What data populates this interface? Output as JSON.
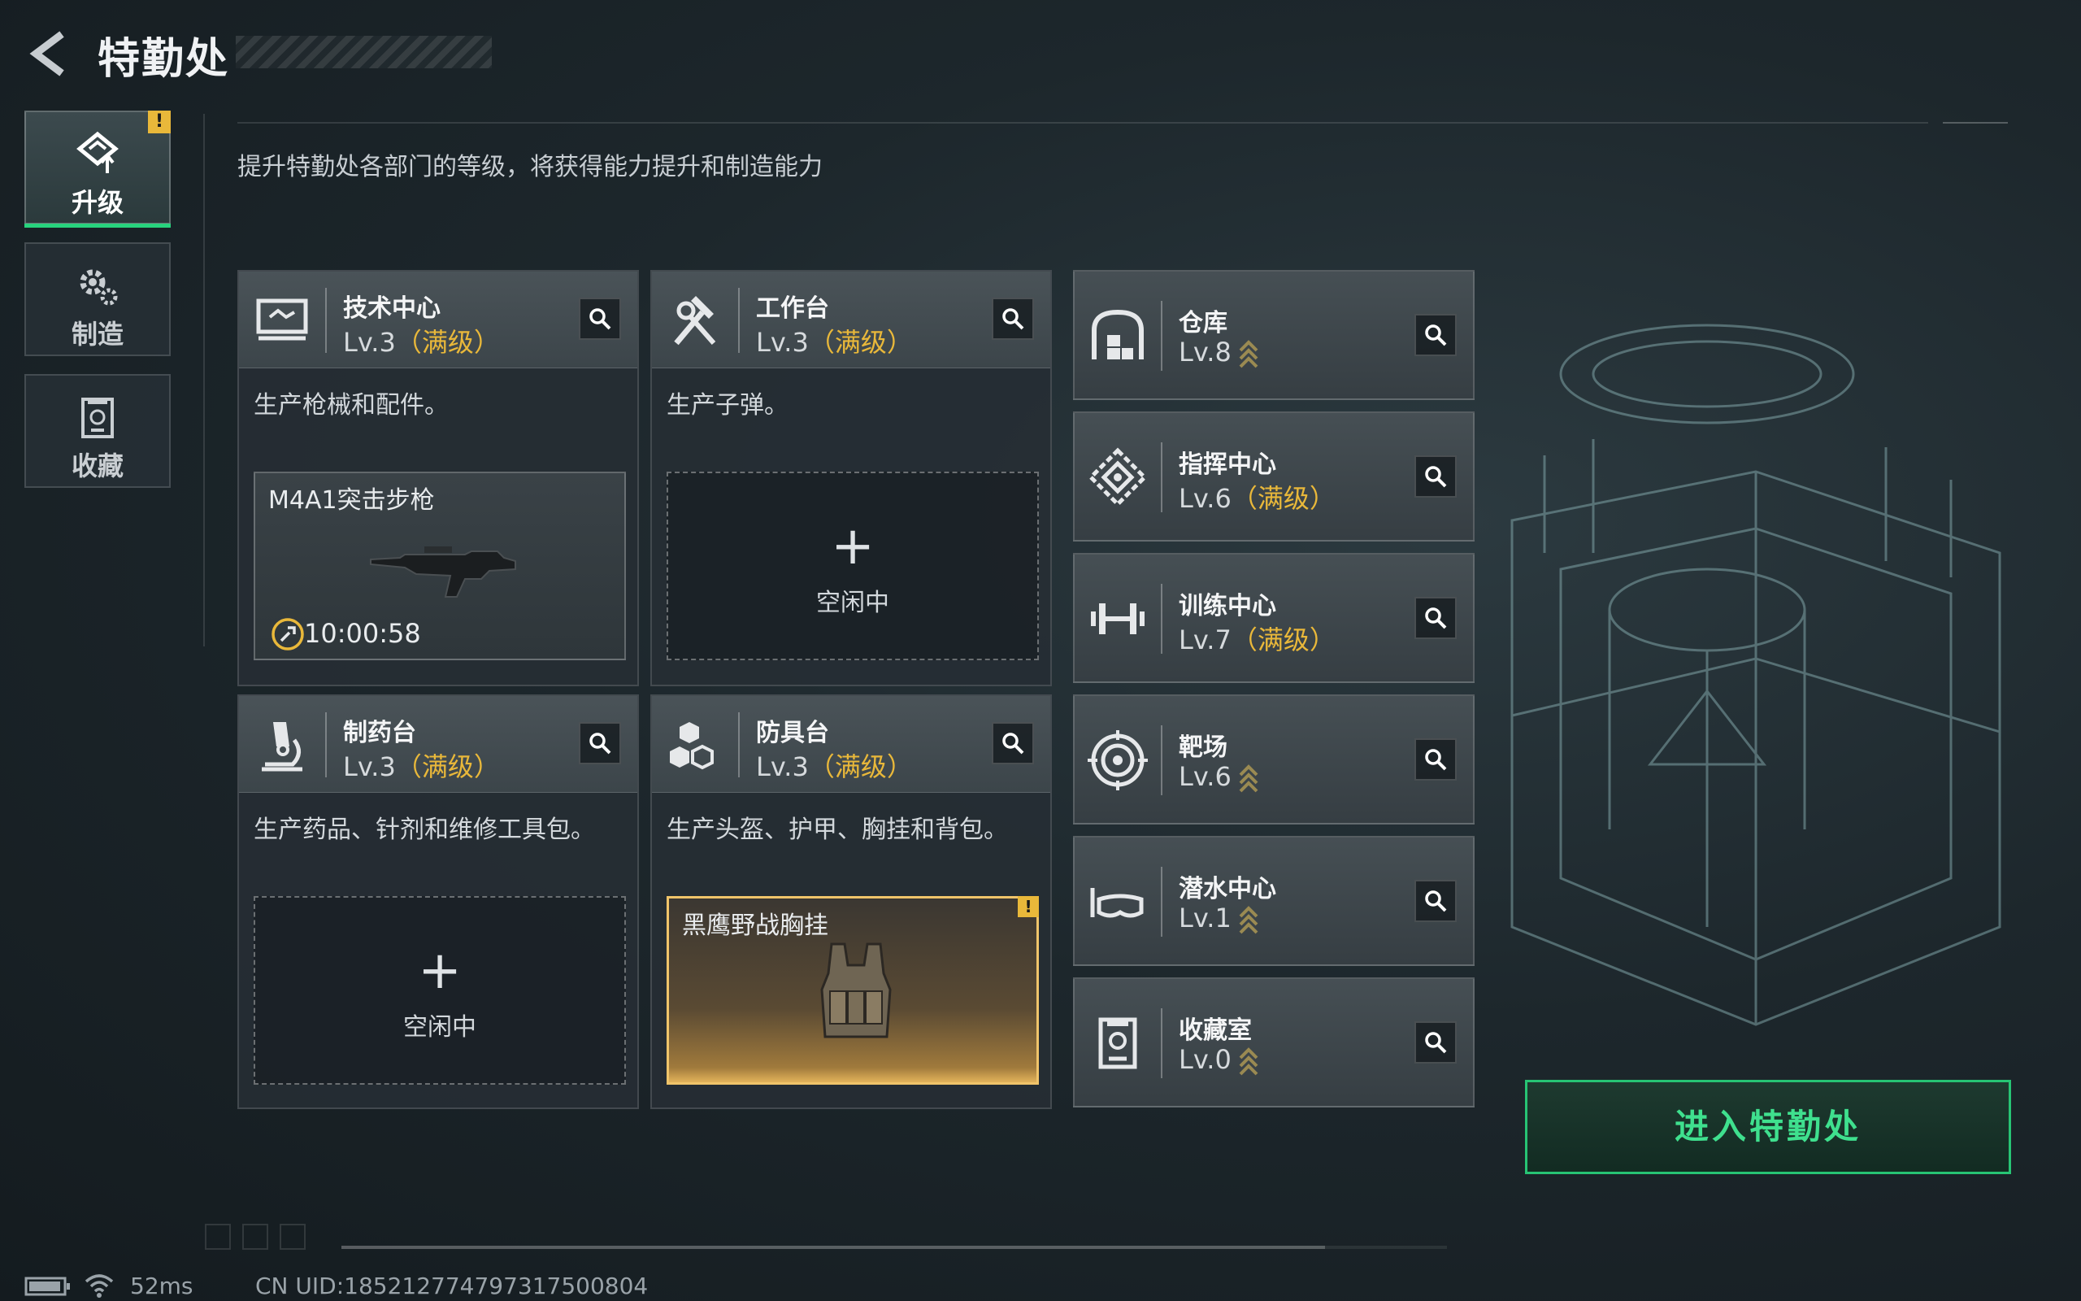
{
  "header": {
    "title": "特勤处"
  },
  "description": "提升特勤处各部门的等级，将获得能力提升和制造能力",
  "tabs": [
    {
      "label": "升级",
      "icon": "upgrade-icon",
      "active": true,
      "badge": "!"
    },
    {
      "label": "制造",
      "icon": "gear-icon",
      "active": false
    },
    {
      "label": "收藏",
      "icon": "trophy-case-icon",
      "active": false
    }
  ],
  "facilities": [
    {
      "name": "技术中心",
      "level": "Lv.3",
      "max": "（满级）",
      "desc": "生产枪械和配件。",
      "icon": "monitor-icon",
      "slot": {
        "state": "busy",
        "item": "M4A1突击步枪",
        "timer": "10:00:58"
      }
    },
    {
      "name": "工作台",
      "level": "Lv.3",
      "max": "（满级）",
      "desc": "生产子弹。",
      "icon": "hammer-wrench-icon",
      "slot": {
        "state": "idle",
        "plus": "+",
        "label": "空闲中"
      }
    },
    {
      "name": "制药台",
      "level": "Lv.3",
      "max": "（满级）",
      "desc": "生产药品、针剂和维修工具包。",
      "icon": "microscope-icon",
      "slot": {
        "state": "idle",
        "plus": "+",
        "label": "空闲中"
      }
    },
    {
      "name": "防具台",
      "level": "Lv.3",
      "max": "（满级）",
      "desc": "生产头盔、护甲、胸挂和背包。",
      "icon": "cubes-icon",
      "slot": {
        "state": "done",
        "item": "黑鹰野战胸挂",
        "badge": "!"
      }
    }
  ],
  "side_list": [
    {
      "name": "仓库",
      "level": "Lv.8",
      "max": "",
      "upgradable": true,
      "icon": "warehouse-icon"
    },
    {
      "name": "指挥中心",
      "level": "Lv.6",
      "max": "（满级）",
      "upgradable": false,
      "icon": "command-icon"
    },
    {
      "name": "训练中心",
      "level": "Lv.7",
      "max": "（满级）",
      "upgradable": false,
      "icon": "dumbbell-icon"
    },
    {
      "name": "靶场",
      "level": "Lv.6",
      "max": "",
      "upgradable": true,
      "icon": "target-icon"
    },
    {
      "name": "潜水中心",
      "level": "Lv.1",
      "max": "",
      "upgradable": true,
      "icon": "diving-mask-icon"
    },
    {
      "name": "收藏室",
      "level": "Lv.0",
      "max": "",
      "upgradable": true,
      "icon": "trophy-case-icon"
    }
  ],
  "enter_button": "进入特勤处",
  "footer": {
    "ping": "52ms",
    "uid": "CN UID:185212774797317500804"
  },
  "colors": {
    "accent": "#27d37d",
    "gold": "#e9b83a"
  }
}
